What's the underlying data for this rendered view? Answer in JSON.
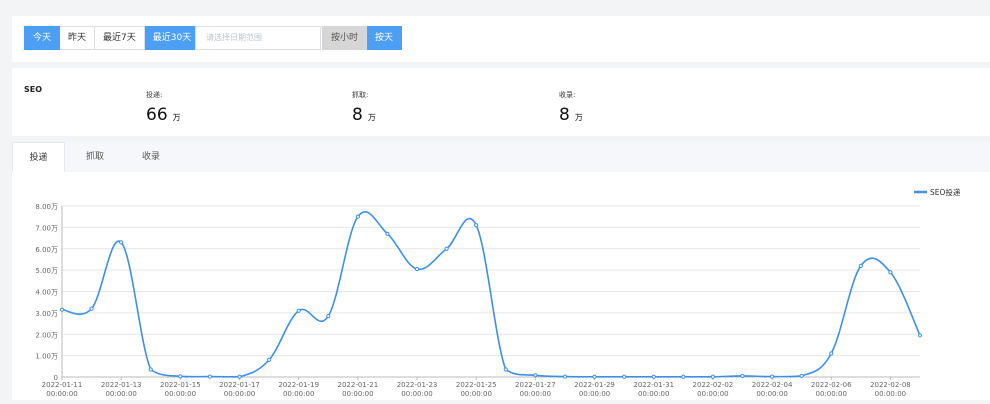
{
  "filters": {
    "range_buttons": [
      {
        "label": "今天",
        "active": true
      },
      {
        "label": "昨天",
        "active": false
      },
      {
        "label": "最近7天",
        "active": false
      },
      {
        "label": "最近30天",
        "active": true
      }
    ],
    "date_placeholder": "请选择日期范围",
    "granularity_buttons": [
      {
        "label": "按小时",
        "active": false
      },
      {
        "label": "按天",
        "active": true
      }
    ]
  },
  "stats": {
    "section_title": "SEO",
    "items": [
      {
        "label": "投递:",
        "value": "66",
        "unit": "万"
      },
      {
        "label": "抓取:",
        "value": "8",
        "unit": "万"
      },
      {
        "label": "收录:",
        "value": "8",
        "unit": "万"
      }
    ]
  },
  "tabs": [
    {
      "label": "投递",
      "active": true
    },
    {
      "label": "抓取",
      "active": false
    },
    {
      "label": "收录",
      "active": false
    }
  ],
  "colors": {
    "accent": "#4d9ff4",
    "line": "#3f8fe8",
    "grid": "#e6e6e6"
  },
  "chart_data": {
    "type": "line",
    "ylim": [
      0,
      8
    ],
    "y_ticks": [
      "0",
      "1.00万",
      "2.00万",
      "3.00万",
      "4.00万",
      "5.00万",
      "6.00万",
      "7.00万",
      "8.00万"
    ],
    "x_ticks": [
      {
        "date": "2022-01-11",
        "time": "00:00:00"
      },
      {
        "date": "2022-01-13",
        "time": "00:00:00"
      },
      {
        "date": "2022-01-15",
        "time": "00:00:00"
      },
      {
        "date": "2022-01-17",
        "time": "00:00:00"
      },
      {
        "date": "2022-01-19",
        "time": "00:00:00"
      },
      {
        "date": "2022-01-21",
        "time": "00:00:00"
      },
      {
        "date": "2022-01-23",
        "time": "00:00:00"
      },
      {
        "date": "2022-01-25",
        "time": "00:00:00"
      },
      {
        "date": "2022-01-27",
        "time": "00:00:00"
      },
      {
        "date": "2022-01-29",
        "time": "00:00:00"
      },
      {
        "date": "2022-01-31",
        "time": "00:00:00"
      },
      {
        "date": "2022-02-02",
        "time": "00:00:00"
      },
      {
        "date": "2022-02-04",
        "time": "00:00:00"
      },
      {
        "date": "2022-02-06",
        "time": "00:00:00"
      },
      {
        "date": "2022-02-08",
        "time": "00:00:00"
      }
    ],
    "x": [
      "2022-01-11",
      "2022-01-12",
      "2022-01-13",
      "2022-01-14",
      "2022-01-15",
      "2022-01-16",
      "2022-01-17",
      "2022-01-18",
      "2022-01-19",
      "2022-01-20",
      "2022-01-21",
      "2022-01-22",
      "2022-01-23",
      "2022-01-24",
      "2022-01-25",
      "2022-01-26",
      "2022-01-27",
      "2022-01-28",
      "2022-01-29",
      "2022-01-30",
      "2022-01-31",
      "2022-02-01",
      "2022-02-02",
      "2022-02-03",
      "2022-02-04",
      "2022-02-05",
      "2022-02-06",
      "2022-02-07",
      "2022-02-08",
      "2022-02-09"
    ],
    "series": [
      {
        "name": "SEO投递",
        "values": [
          3.15,
          3.2,
          6.3,
          0.35,
          0.03,
          0.02,
          0.01,
          0.8,
          3.1,
          2.85,
          7.5,
          6.7,
          5.05,
          6.0,
          7.1,
          0.35,
          0.08,
          0.02,
          0.01,
          0.01,
          0.01,
          0.01,
          0.01,
          0.05,
          0.02,
          0.05,
          1.1,
          5.2,
          4.9,
          1.95
        ]
      }
    ],
    "legend": "top-right",
    "grid": true
  }
}
